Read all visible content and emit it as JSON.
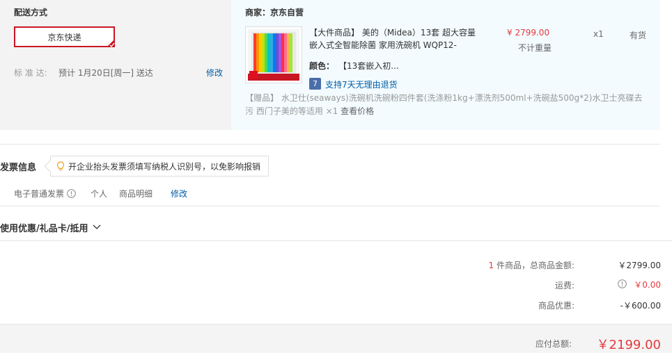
{
  "shipping": {
    "title": "配送方式",
    "method": "京东快递",
    "standard_label": "标 准 达:",
    "standard_value": "预计 1月20日[周一] 送达",
    "modify": "修改"
  },
  "order": {
    "merchant": "商家：京东自营",
    "product_title": "【大件商品】 美的（Midea）13套 超大容量嵌入式全智能除菌 家用洗碗机 WQP12-",
    "color_label": "颜色：",
    "color_value": "【13套嵌入初...",
    "price": "¥ 2799.00",
    "weight": "不计重量",
    "qty": "x1",
    "stock": "有货",
    "return_badge": "7",
    "return_text": "支持7天无理由退货",
    "gift_text": "【赠品】  水卫仕(seaways)洗碗机洗碗粉四件套(洗涤粉1kg+漂洗剂500ml+洗碗盐500g*2)水卫士亮碟去污 西门子美的等适用 ×1",
    "gift_view": "查看价格"
  },
  "invoice": {
    "title": "发票信息",
    "tip": "开企业抬头发票须填写纳税人识别号，以免影响报销",
    "type": "电子普通发票",
    "personal": "个人",
    "detail": "商品明细",
    "modify": "修改"
  },
  "coupon": {
    "title": "使用优惠/礼品卡/抵用"
  },
  "summary": {
    "count": "1",
    "count_label": " 件商品，总商品金额:",
    "amount": "￥2799.00",
    "freight_label": "运费:",
    "freight": "￥0.00",
    "discount_label": "商品优惠:",
    "discount": "-￥600.00",
    "total_label": "应付总额:",
    "total": "￥2199.00"
  },
  "colors": {
    "accent_red": "#e4393c",
    "link_blue": "#005ea7",
    "selected_border": "#c81623"
  }
}
